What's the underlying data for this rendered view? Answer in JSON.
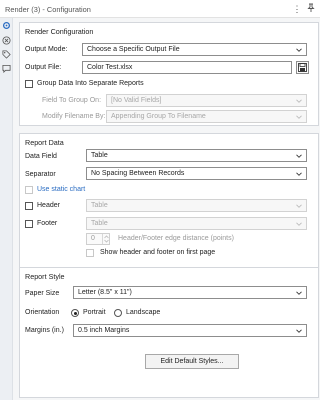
{
  "window": {
    "title": "Render (3) - Configuration"
  },
  "render_config": {
    "section_title": "Render Configuration",
    "output_mode_label": "Output Mode:",
    "output_mode_value": "Choose a Specific Output File",
    "output_file_label": "Output File:",
    "output_file_value": "Color Test.xlsx",
    "group_data_label": "Group Data Into Separate Reports",
    "field_to_group_label": "Field To Group On:",
    "field_to_group_value": "[No Valid Fields]",
    "modify_filename_label": "Modify Filename By:",
    "modify_filename_value": "Appending Group To Filename"
  },
  "report_data": {
    "section_title": "Report Data",
    "data_field_label": "Data Field",
    "data_field_value": "Table",
    "separator_label": "Separator",
    "separator_value": "No Spacing Between Records",
    "static_chart_label": "Use static chart",
    "header_label": "Header",
    "header_value": "Table",
    "footer_label": "Footer",
    "footer_value": "Table",
    "edge_distance_value": "0",
    "edge_distance_label": "Header/Footer edge distance (points)",
    "show_first_page_label": "Show header and footer on first page"
  },
  "report_style": {
    "section_title": "Report Style",
    "paper_size_label": "Paper Size",
    "paper_size_value": "Letter (8.5\" x 11\")",
    "orientation_label": "Orientation",
    "portrait_label": "Portrait",
    "landscape_label": "Landscape",
    "margins_label": "Margins (in.)",
    "margins_value": "0.5 inch Margins",
    "edit_styles_button": "Edit Default Styles..."
  },
  "colors": {
    "accent": "#2a6cc2",
    "disabled_text": "#9a9a9a",
    "panel_bg": "#ffffff"
  }
}
